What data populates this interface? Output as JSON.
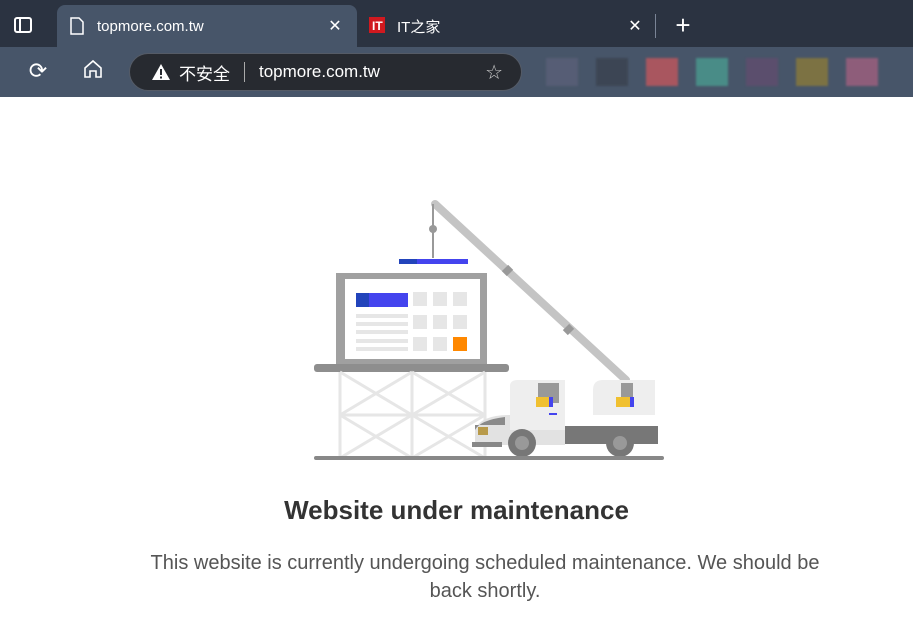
{
  "browser": {
    "tabs": [
      {
        "label": "topmore.com.tw",
        "icon": "page-icon",
        "active": true
      },
      {
        "label": "IT之家",
        "icon": "ithome-favicon",
        "active": false
      }
    ],
    "close_glyph": "✕",
    "new_tab_glyph": "+",
    "address": {
      "security_label": "不安全",
      "url": "topmore.com.tw"
    },
    "bookmark_colors": [
      "#5a5f78",
      "#3a424f",
      "#c2575d",
      "#4a9a8f",
      "#604d6e",
      "#8a7a3a",
      "#a0607f"
    ]
  },
  "page": {
    "title": "Website under maintenance",
    "message": "This website is currently undergoing scheduled maintenance. We should be back shortly."
  },
  "colors": {
    "accent_blue": "#4444ee",
    "accent_orange": "#ff8800"
  }
}
